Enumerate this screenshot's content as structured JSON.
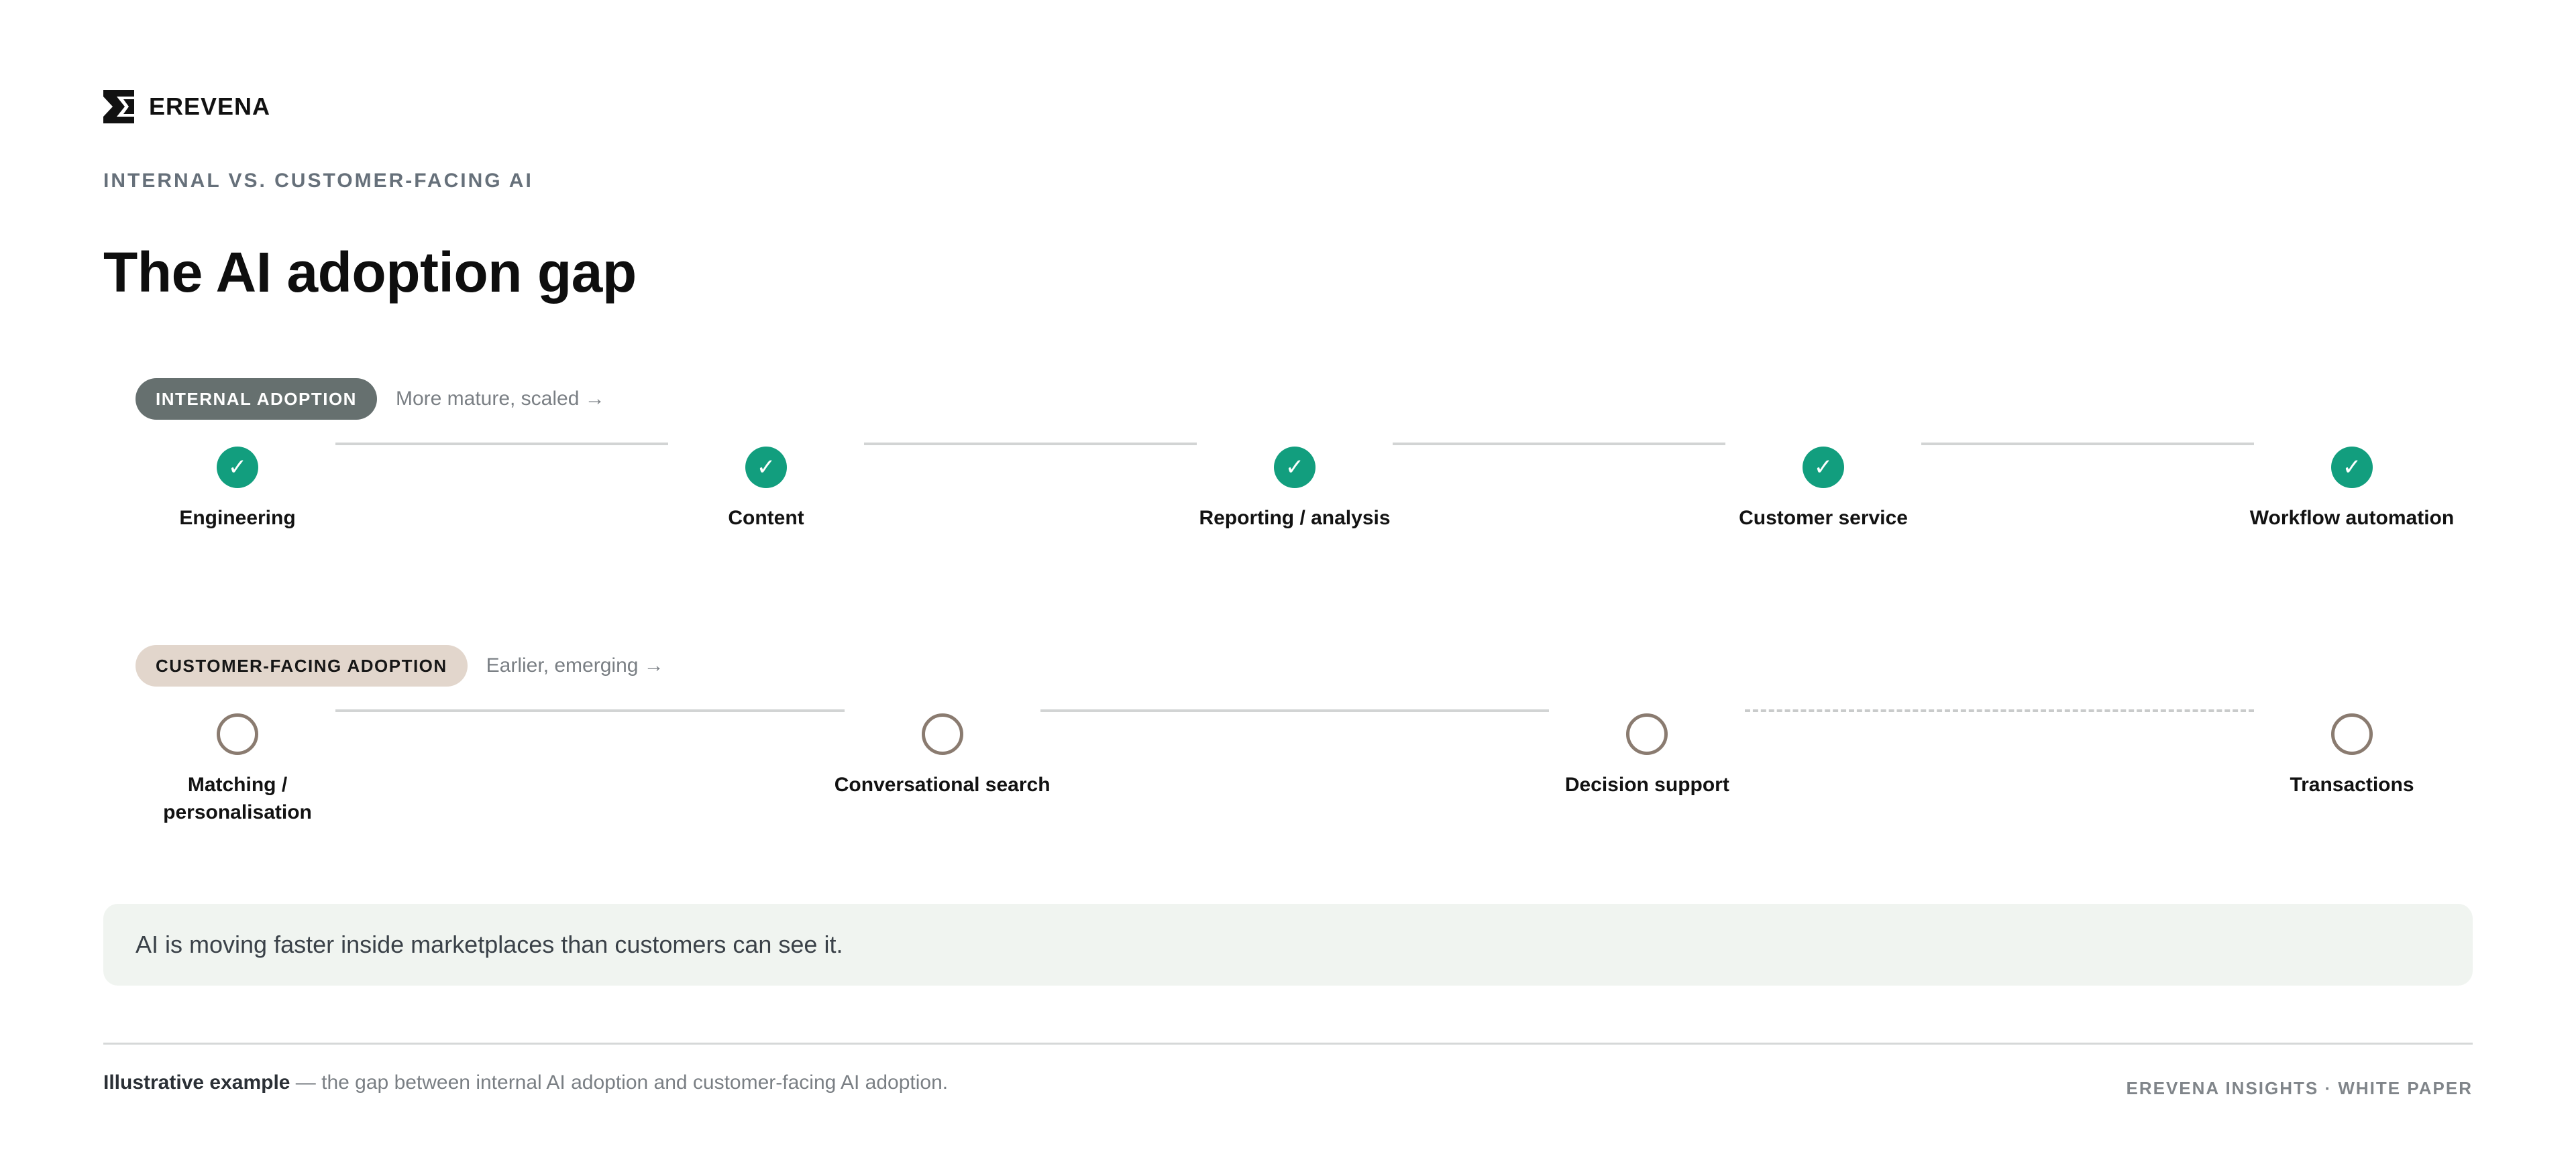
{
  "brand": {
    "name": "EREVENA",
    "logo_icon": "erevena-logo-icon",
    "logo_color": "#111111"
  },
  "eyebrow": "INTERNAL VS. CUSTOMER-FACING AI",
  "title": "The AI adoption gap",
  "colors": {
    "done": "#129e7e",
    "open_ring": "#8a7b70",
    "internal_pill": "#66706f",
    "customer_pill": "#e2d6cc",
    "callout_bg": "#f0f4f0"
  },
  "tracks": {
    "internal": {
      "label": "INTERNAL ADOPTION",
      "note": "More mature, scaled →",
      "stages": [
        {
          "label": "Engineering",
          "status": "done",
          "icon": "check-icon"
        },
        {
          "label": "Content",
          "status": "done",
          "icon": "check-icon"
        },
        {
          "label": "Reporting / analysis",
          "status": "done",
          "icon": "check-icon"
        },
        {
          "label": "Customer service",
          "status": "done",
          "icon": "check-icon"
        },
        {
          "label": "Workflow automation",
          "status": "done",
          "icon": "check-icon"
        }
      ],
      "connector_styles": [
        "solid",
        "solid",
        "solid",
        "solid"
      ]
    },
    "customer": {
      "label": "CUSTOMER-FACING ADOPTION",
      "note": "Earlier, emerging →",
      "stages": [
        {
          "label": "Matching / personalisation",
          "status": "open",
          "icon": "empty-circle-icon"
        },
        {
          "label": "Conversational search",
          "status": "open",
          "icon": "empty-circle-icon"
        },
        {
          "label": "Decision support",
          "status": "open",
          "icon": "empty-circle-icon"
        },
        {
          "label": "Transactions",
          "status": "open",
          "icon": "empty-circle-icon"
        }
      ],
      "connector_styles": [
        "solid",
        "solid",
        "dashed"
      ]
    }
  },
  "callout": "AI is moving faster inside marketplaces than customers can see it.",
  "footer": {
    "note_strong": "Illustrative example",
    "note_rest": " — the gap between internal AI adoption and customer-facing AI adoption.",
    "source": "EREVENA INSIGHTS · WHITE PAPER"
  }
}
